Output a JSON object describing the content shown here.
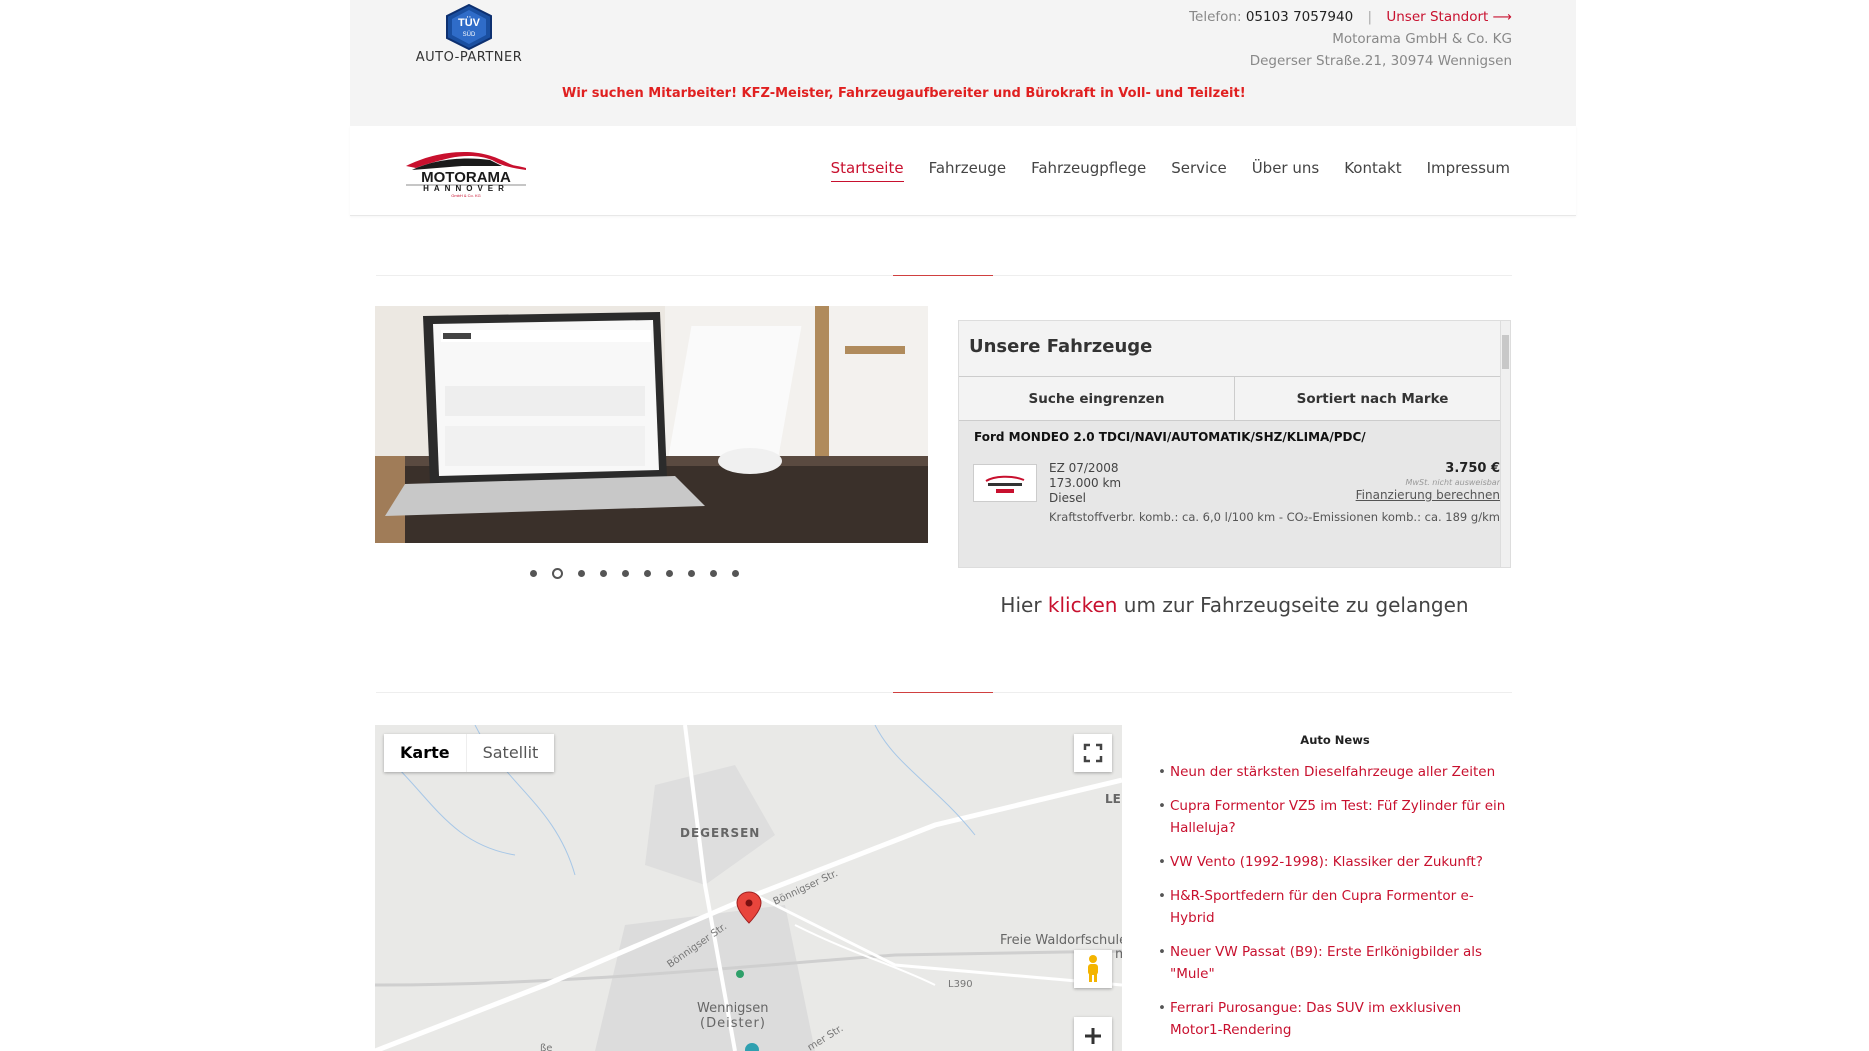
{
  "topbar": {
    "tuv_caption": "AUTO-PARTNER",
    "tuv_mark": "TÜV",
    "tuv_sub": "SÜD",
    "phone_label": "Telefon:",
    "phone": "05103 7057940",
    "separator": "|",
    "location_link": "Unser Standort ⟶",
    "company": "Motorama GmbH & Co. KG",
    "address": "Degerser Straße.21, 30974 Wennigsen",
    "jobs": "Wir suchen Mitarbeiter! KFZ-Meister, Fahrzeugaufbereiter und Bürokraft in Voll- und Teilzeit!"
  },
  "logo": {
    "name": "MOTORAMA",
    "city": "HANNOVER",
    "sub": "GmbH & Co. KG"
  },
  "nav": {
    "items": [
      "Startseite",
      "Fahrzeuge",
      "Fahrzeugpflege",
      "Service",
      "Über uns",
      "Kontakt",
      "Impressum"
    ],
    "active": "Startseite"
  },
  "slider": {
    "dot_count": 10,
    "active_index": 1
  },
  "vehicles": {
    "title": "Unsere Fahrzeuge",
    "tab_filter": "Suche eingrenzen",
    "tab_sort": "Sortiert nach Marke",
    "car_title": "Ford MONDEO 2.0 TDCI/NAVI/AUTOMATIK/SHZ/KLIMA/PDC/",
    "ez": "EZ 07/2008",
    "km": "173.000 km",
    "fuel": "Diesel",
    "price": "3.750 €",
    "vat_note": "MwSt. nicht ausweisbar",
    "finance": "Finanzierung berechnen",
    "consumption": "Kraftstoffverbr. komb.: ca. 6,0 l/100 km - CO₂-Emissionen komb.: ca. 189 g/km"
  },
  "cta": {
    "before": "Hier ",
    "link": "klicken",
    "after": " um zur Fahrzeugseite zu gelangen"
  },
  "map": {
    "type_map": "Karte",
    "type_satellite": "Satellit",
    "labels": {
      "degersen": "DEGERSEN",
      "wennigsen1": "Wennigsen",
      "wennigsen2": "(Deister)",
      "school1": "Freie Waldorfschule",
      "school2": "m",
      "road_l390": "L390",
      "boennigser1": "Bönnigser Str.",
      "boennigser2": "Bönnigser Str.",
      "edge": "LE",
      "edge2": "ße",
      "edge3": "mer Str."
    }
  },
  "news": {
    "title": "Auto News",
    "items": [
      "Neun der stärksten Dieselfahrzeuge aller Zeiten",
      "Cupra Formentor VZ5 im Test: Füf Zylinder für ein Halleluja?",
      "VW Vento (1992-1998): Klassiker der Zukunft?",
      "H&R-Sportfedern für den Cupra Formentor e-Hybrid",
      "Neuer VW Passat (B9): Erste Erlkönigbilder als \"Mule\"",
      "Ferrari Purosangue: Das SUV im exklusiven Motor1-Rendering"
    ]
  },
  "colors": {
    "accent": "#c8102e",
    "jobs": "#e02020",
    "topbar": "#f4f4f4"
  }
}
